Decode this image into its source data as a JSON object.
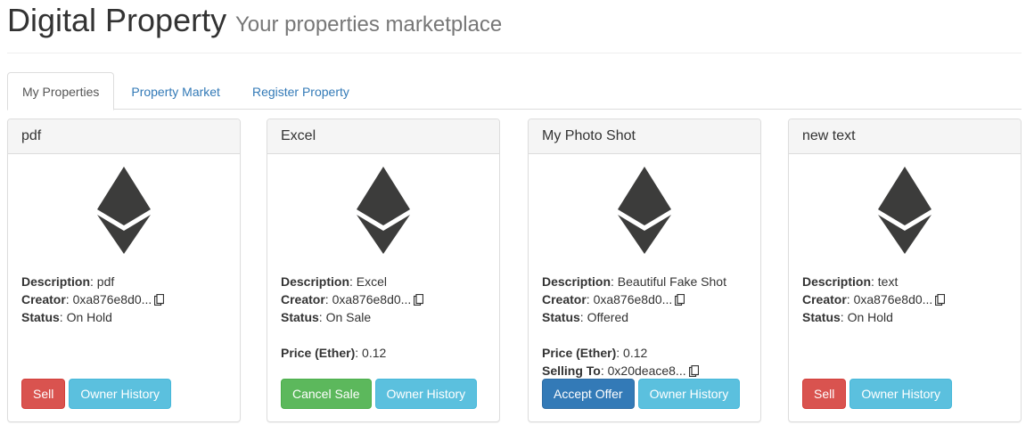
{
  "header": {
    "title": "Digital Property",
    "subtitle": "Your properties marketplace"
  },
  "tabs": [
    {
      "label": "My Properties",
      "active": true
    },
    {
      "label": "Property Market",
      "active": false
    },
    {
      "label": "Register Property",
      "active": false
    }
  ],
  "labels": {
    "description": "Description",
    "creator": "Creator",
    "status": "Status",
    "price": "Price (Ether)",
    "selling_to": "Selling To"
  },
  "icon_names": {
    "property": "ethereum-icon",
    "copy": "copy-icon"
  },
  "colors": {
    "danger": "#d9534f",
    "info": "#5bc0de",
    "success": "#5cb85c",
    "primary": "#337ab7",
    "icon": "#3c3c3b"
  },
  "cards": [
    {
      "title": "pdf",
      "description": "pdf",
      "creator": "0xa876e8d0...",
      "status": "On Hold",
      "buttons": {
        "primary": "Sell",
        "history": "Owner History"
      }
    },
    {
      "title": "Excel",
      "description": "Excel",
      "creator": "0xa876e8d0...",
      "status": "On Sale",
      "price": "0.12",
      "buttons": {
        "primary": "Cancel Sale",
        "history": "Owner History"
      }
    },
    {
      "title": "My Photo Shot",
      "description": "Beautiful Fake Shot",
      "creator": "0xa876e8d0...",
      "status": "Offered",
      "price": "0.12",
      "selling_to": "0x20deace8...",
      "buttons": {
        "primary": "Accept Offer",
        "history": "Owner History"
      }
    },
    {
      "title": "new text",
      "description": "text",
      "creator": "0xa876e8d0...",
      "status": "On Hold",
      "buttons": {
        "primary": "Sell",
        "history": "Owner History"
      }
    }
  ]
}
